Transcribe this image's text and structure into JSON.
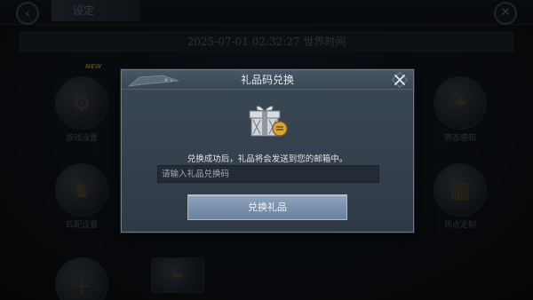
{
  "background": {
    "screen_title": "设定",
    "back_icon": "back-arrow-icon",
    "close_icon": "close-icon",
    "server_time": "2025-07-01 02:32:27 世界时间",
    "new_badge": "NEW",
    "tiles": [
      {
        "label": "游戏设置",
        "icon": "gear-icon"
      },
      {
        "label": "匹配设置",
        "icon": "chess-knight-icon"
      },
      {
        "label": "",
        "icon": "plus-icon"
      },
      {
        "label": "",
        "icon": "rifle-icon"
      },
      {
        "label": "势态感知",
        "icon": "medal-icon"
      },
      {
        "label": "热点定制",
        "icon": "map-icon"
      }
    ]
  },
  "modal": {
    "title": "礼品码兑换",
    "close_icon": "close-x-icon",
    "gift_icon": "gift-box-icon",
    "info_text": "兑换成功后，礼品将会发送到您的邮箱中。",
    "input": {
      "placeholder": "请输入礼品兑换码",
      "value": ""
    },
    "redeem_button": "兑换礼品"
  },
  "colors": {
    "modal_bg": "#33404c",
    "button_bg": "#7d93ad",
    "header_bg": "#404e5c"
  }
}
